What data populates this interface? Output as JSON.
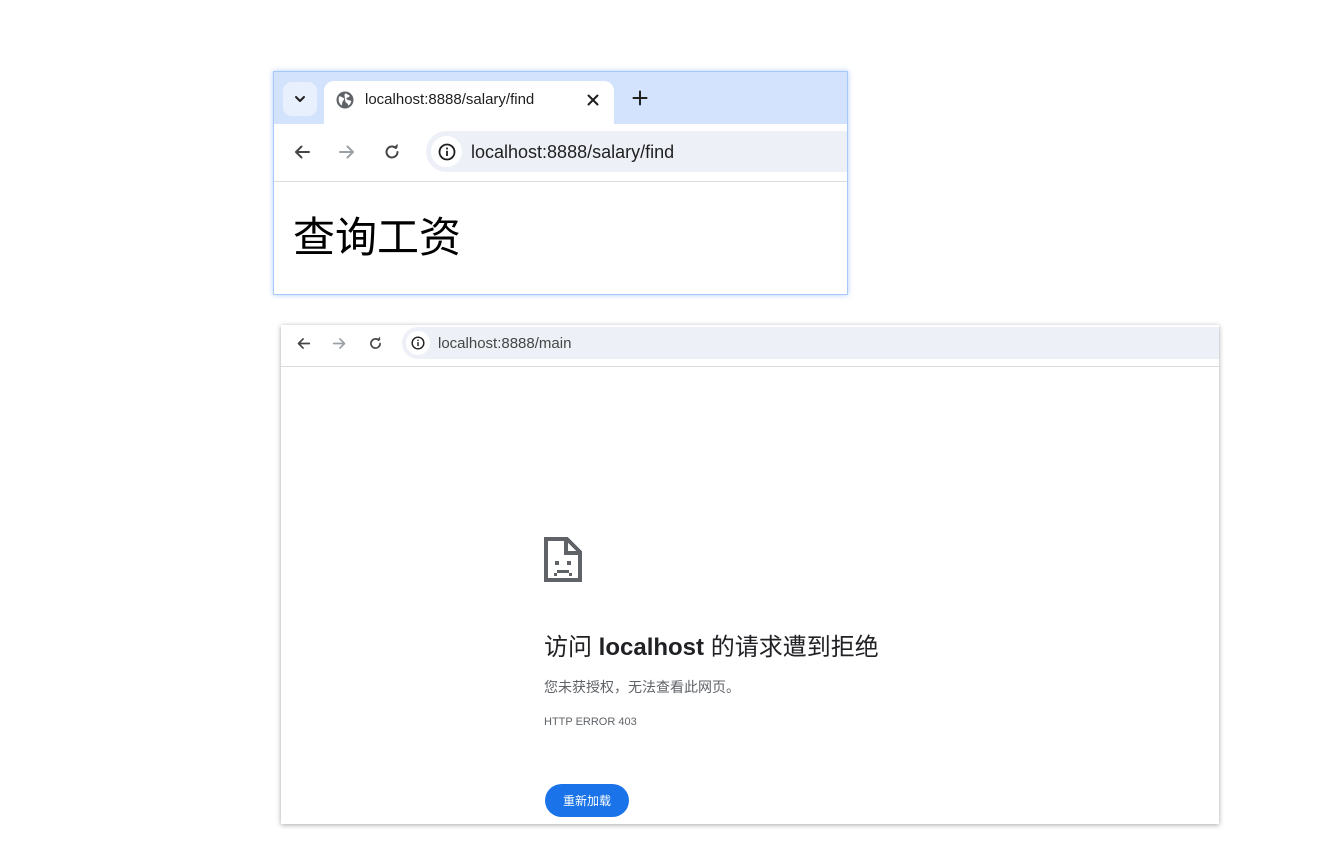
{
  "window1": {
    "tab": {
      "title": "localhost:8888/salary/find"
    },
    "omnibox": {
      "url": "localhost:8888/salary/find"
    },
    "page": {
      "heading": "查询工资"
    }
  },
  "window2": {
    "omnibox": {
      "url": "localhost:8888/main"
    },
    "error": {
      "title_prefix": "访问 ",
      "title_host": "localhost",
      "title_suffix": " 的请求遭到拒绝",
      "description": "您未获授权，无法查看此网页。",
      "code": "HTTP ERROR 403",
      "reload_label": "重新加载"
    }
  },
  "icons": {
    "tab_search": "chevron-down-icon",
    "favicon": "globe-icon",
    "close": "close-icon",
    "new_tab": "plus-icon",
    "back": "arrow-left-icon",
    "forward": "arrow-right-icon",
    "reload": "reload-icon",
    "site_info": "info-icon",
    "error": "sad-document-icon"
  },
  "colors": {
    "tabstrip": "#d3e3fd",
    "omnibox": "#edf0f7",
    "accent": "#1a73e8"
  }
}
